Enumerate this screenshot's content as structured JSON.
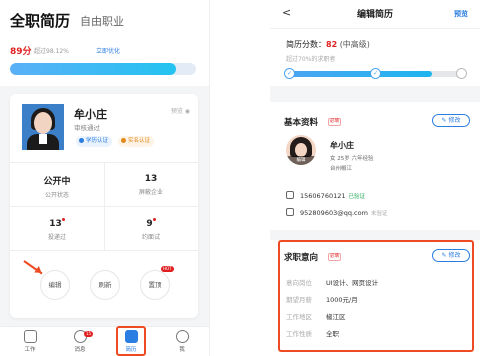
{
  "left": {
    "title": "全职简历",
    "tab2": "自由职业",
    "score": "89分",
    "beat": "超过98.12%",
    "optimize": "立即优化",
    "score_fraction": 0.89,
    "card": {
      "name": "牟小庄",
      "review": "审核通过",
      "preview": "预览",
      "badges": [
        "学历认证",
        "实名认证"
      ],
      "stats": [
        {
          "value": "公开中",
          "label": "公开状态"
        },
        {
          "value": "13",
          "label": "屏蔽企业"
        },
        {
          "value": "13",
          "label": "投递过"
        },
        {
          "value": "9",
          "label": "约面试"
        }
      ],
      "actions": [
        "编辑",
        "刷新",
        "置顶"
      ],
      "hot": "HOT"
    },
    "tabbar": [
      {
        "label": "工作",
        "icon": "briefcase-icon"
      },
      {
        "label": "消息",
        "icon": "chat-icon",
        "badge": "15"
      },
      {
        "label": "简历",
        "icon": "resume-icon"
      },
      {
        "label": "我",
        "icon": "user-icon"
      }
    ],
    "colors": {
      "accent": "#2a7de1",
      "highlight": "#ee4a23",
      "red": "#e02020"
    }
  },
  "right": {
    "back": "<",
    "title": "编辑简历",
    "preview": "预览",
    "score_label": "简历分数：",
    "score": "82",
    "level": "(中高级)",
    "beat": "超过70%的求职者",
    "score_fraction": 0.82,
    "basic": {
      "title": "基本资料",
      "must": "必填",
      "edit": "修改",
      "avatar_tag": "编辑",
      "name": "牟小庄",
      "meta": "女  25岁  六年经验",
      "city": "台州椒江",
      "phone": "15606760121",
      "phone_status": "已验证",
      "email": "952809603@qq.com",
      "email_status": "未验证"
    },
    "intent": {
      "title": "求职意向",
      "must": "必填",
      "edit": "修改",
      "rows": [
        {
          "label": "意向岗位",
          "value": "UI设计、网页设计"
        },
        {
          "label": "期望月薪",
          "value": "1000元/月"
        },
        {
          "label": "工作地区",
          "value": "椒江区"
        },
        {
          "label": "工作性质",
          "value": "全职"
        }
      ]
    }
  }
}
